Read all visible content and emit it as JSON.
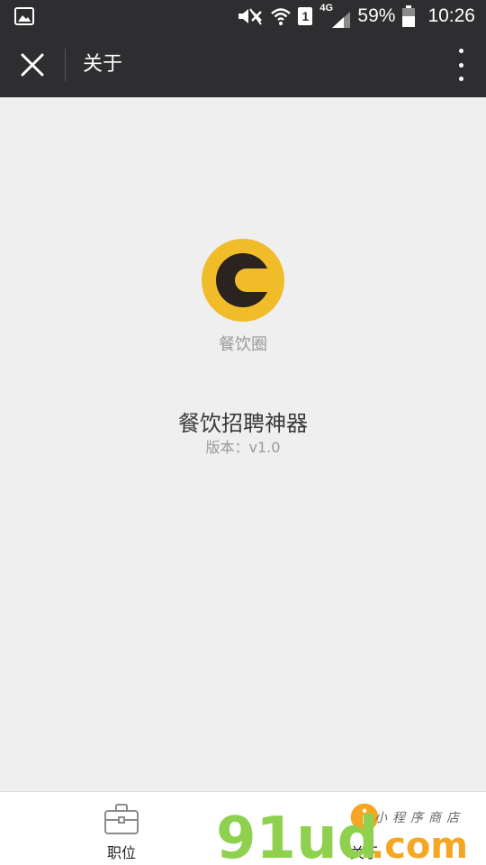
{
  "status_bar": {
    "battery_percent": "59%",
    "time": "10:26",
    "network_type": "4G",
    "sim_slot": "1",
    "icons": [
      "gallery-icon",
      "mute-icon",
      "wifi-icon",
      "sim-icon",
      "signal-icon",
      "battery-icon"
    ]
  },
  "nav": {
    "title": "关于",
    "icons": [
      "close-icon",
      "more-icon"
    ]
  },
  "about": {
    "logo_letter": "C",
    "brand_name": "餐饮圈",
    "app_name": "餐饮招聘神器",
    "version": "版本：v1.0"
  },
  "tabs": [
    {
      "label": "职位",
      "icon": "briefcase-icon",
      "active": false
    },
    {
      "label": "关于",
      "icon": "info-icon",
      "active": true
    }
  ],
  "watermark": {
    "logo_text": "91ud",
    "domain": ".com",
    "tagline": "小程序商店",
    "info_glyph": "i"
  },
  "colors": {
    "bar_background": "#2e2e30",
    "page_background": "#efefef",
    "logo_yellow": "#f0bc2a",
    "logo_dark": "#2b2320",
    "watermark_green": "#8fd14f",
    "watermark_orange": "#f5a623"
  }
}
